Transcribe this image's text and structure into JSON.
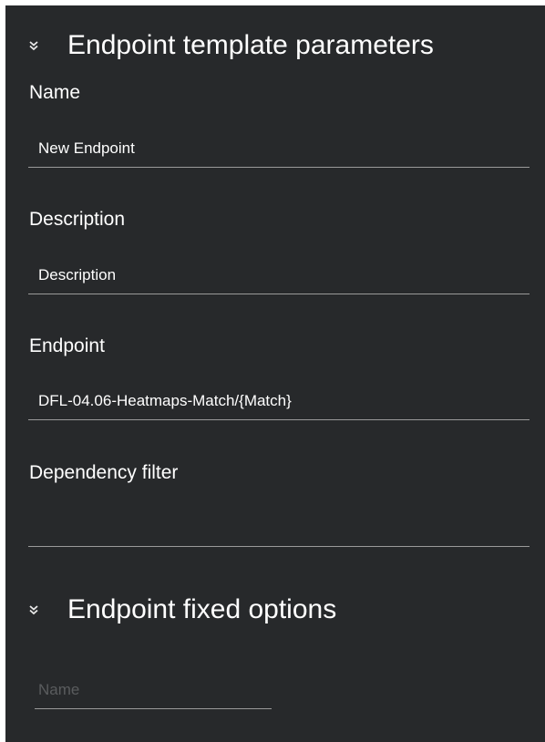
{
  "template_section": {
    "title": "Endpoint template parameters",
    "icon": "chevron-double-down-icon",
    "fields": [
      {
        "label": "Name",
        "value": "New Endpoint",
        "placeholder": ""
      },
      {
        "label": "Description",
        "value": "Description",
        "placeholder": ""
      },
      {
        "label": "Endpoint",
        "value": "DFL-04.06-Heatmaps-Match/{Match}",
        "placeholder": ""
      },
      {
        "label": "Dependency filter",
        "value": "",
        "placeholder": ""
      }
    ]
  },
  "fixed_section": {
    "title": "Endpoint fixed options",
    "icon": "chevron-double-down-icon",
    "name_input": {
      "value": "",
      "placeholder": "Name"
    }
  },
  "colors": {
    "panel_background": "#27292b",
    "text": "#ffffff",
    "underline": "#9a9a9a",
    "placeholder": "#5a5c5e"
  }
}
